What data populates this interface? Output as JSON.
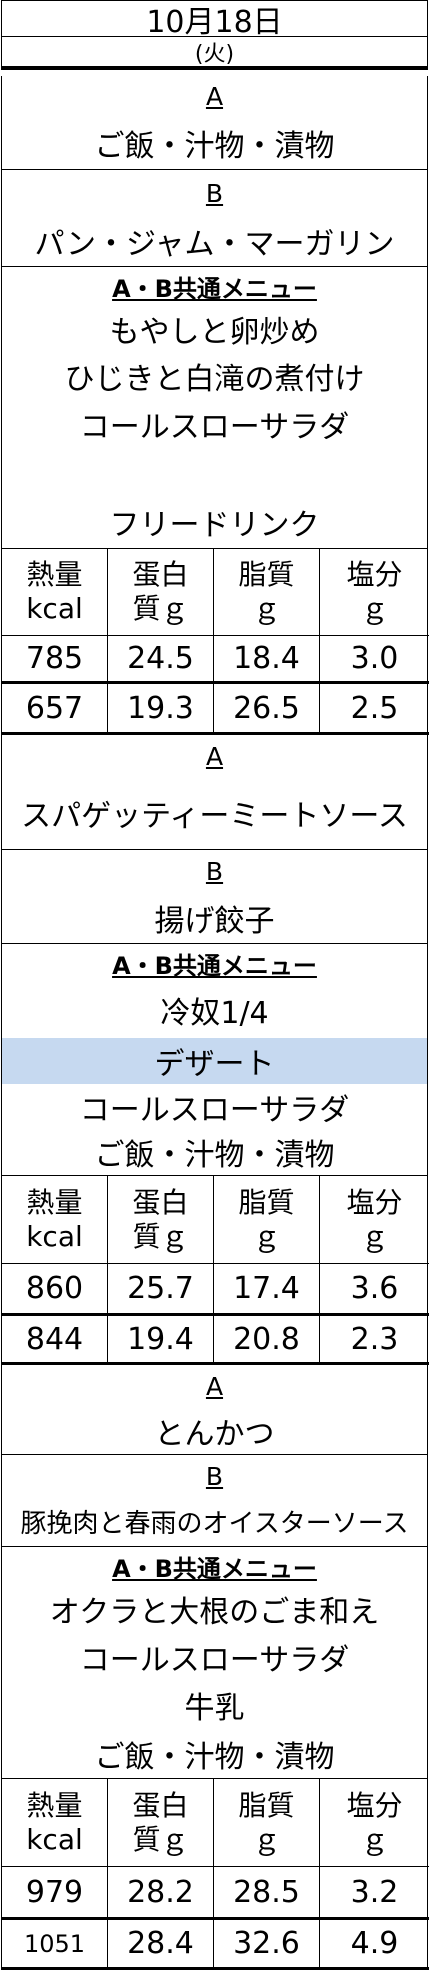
{
  "header": {
    "date": "10月18日",
    "weekday": "(火)"
  },
  "labels": {
    "a": "A",
    "b": "B",
    "ab": "A・B共通メニュー"
  },
  "stat_headers": [
    [
      "熱量",
      "kcal"
    ],
    [
      "蛋白",
      "質ｇ"
    ],
    [
      "脂質",
      "ｇ"
    ],
    [
      "塩分",
      "ｇ"
    ]
  ],
  "meals": [
    {
      "a_item": "ご飯・汁物・漬物",
      "b_item": "パン・ジャム・マーガリン",
      "common": [
        "もやしと卵炒め",
        "ひじきと白滝の煮付け",
        "コールスローサラダ",
        "",
        "フリードリンク"
      ],
      "rows": [
        [
          "785",
          "24.5",
          "18.4",
          "3.0"
        ],
        [
          "657",
          "19.3",
          "26.5",
          "2.5"
        ]
      ]
    },
    {
      "a_item": "スパゲッティーミートソース",
      "b_item": "揚げ餃子",
      "common": [
        "冷奴1/4",
        "デザート",
        "コールスローサラダ",
        "ご飯・汁物・漬物"
      ],
      "rows": [
        [
          "860",
          "25.7",
          "17.4",
          "3.6"
        ],
        [
          "844",
          "19.4",
          "20.8",
          "2.3"
        ]
      ]
    },
    {
      "a_item": "とんかつ",
      "b_item": "豚挽肉と春雨のオイスターソース",
      "common": [
        "オクラと大根のごま和え",
        "コールスローサラダ",
        "牛乳",
        "ご飯・汁物・漬物"
      ],
      "rows": [
        [
          "979",
          "28.2",
          "28.5",
          "3.2"
        ],
        [
          "1051",
          "28.4",
          "32.6",
          "4.9"
        ]
      ]
    }
  ]
}
